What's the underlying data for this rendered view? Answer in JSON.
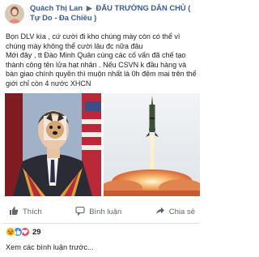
{
  "post": {
    "author": "Quách Thị Lan",
    "target_group": "ĐẤU TRƯỜNG DÂN CHỦ ( Tự Do - Đa Chiều )",
    "lines": [
      "Bọn DLV kìa , cứ cười đi kho chúng mày còn có thể vì chúng mày không thể cười lâu đc nữa đâu",
      "Mới đây , tt Đào Minh Quân cùng các cố vấn đã chế tạo thành công tên lửa hạt nhân . Nếu CSVN k đầu hàng và bàn giao chính quyền thì muộn nhất là 0h đêm mai trên thế giới chỉ còn 4 nước XHCN"
    ]
  },
  "actions": {
    "like": "Thích",
    "comment": "Bình luận",
    "share": "Chia sẻ"
  },
  "reactions": {
    "count": "29",
    "icons": [
      "haha",
      "like",
      "love"
    ],
    "colors": {
      "haha": "#f7b125",
      "like": "#2d88ff",
      "love": "#f33e58"
    }
  },
  "comments": {
    "more_label": "Xem các bình luận trước..."
  }
}
